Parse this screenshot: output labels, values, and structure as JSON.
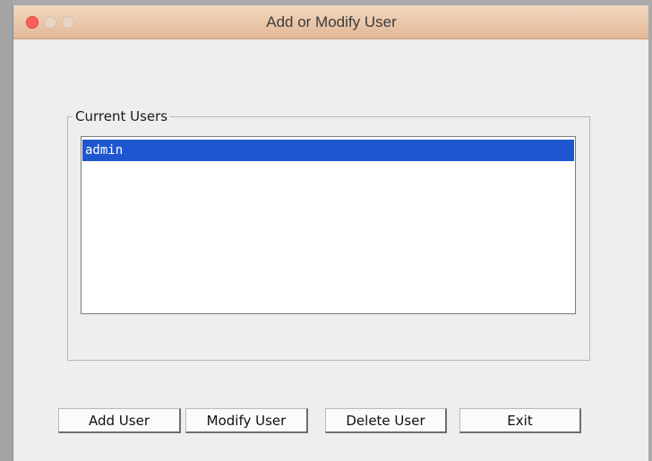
{
  "window": {
    "title": "Add or Modify User"
  },
  "users_group": {
    "label": "Current Users",
    "items": [
      {
        "label": "admin",
        "selected": true
      }
    ]
  },
  "buttons": {
    "add_label": "Add User",
    "modify_label": "Modify User",
    "delete_label": "Delete User",
    "exit_label": "Exit"
  },
  "colors": {
    "selection": "#1f56d0",
    "close_button": "#fb5f57",
    "titlebar": "#e8c3a5"
  }
}
